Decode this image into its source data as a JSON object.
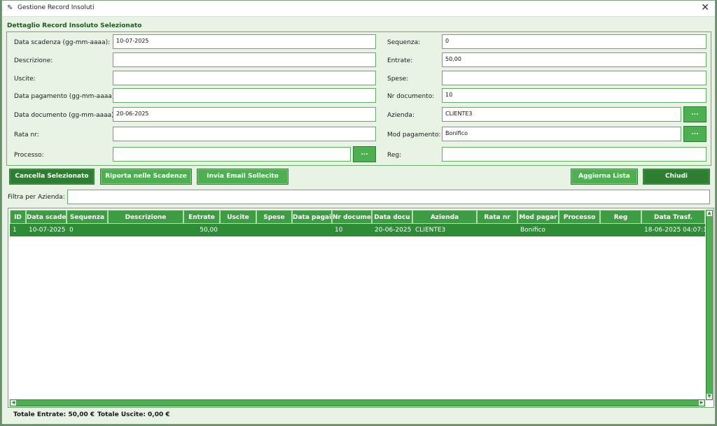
{
  "window": {
    "title": "Gestione Record Insoluti"
  },
  "detail": {
    "section_title": "Dettaglio Record Insoluto Selezionato",
    "fields": {
      "data_scadenza": {
        "label": "Data scadenza (gg-mm-aaaa):",
        "value": "10-07-2025"
      },
      "descrizione": {
        "label": "Descrizione:",
        "value": ""
      },
      "uscite": {
        "label": "Uscite:",
        "value": ""
      },
      "data_pagamento": {
        "label": "Data pagamento (gg-mm-aaaa):",
        "value": ""
      },
      "data_documento": {
        "label": "Data documento (gg-mm-aaaa):",
        "value": "20-06-2025"
      },
      "rata_nr": {
        "label": "Rata nr:",
        "value": ""
      },
      "processo": {
        "label": "Processo:",
        "value": ""
      },
      "sequenza": {
        "label": "Sequenza:",
        "value": "0"
      },
      "entrate": {
        "label": "Entrate:",
        "value": "50,00"
      },
      "spese": {
        "label": "Spese:",
        "value": ""
      },
      "nr_documento": {
        "label": "Nr documento:",
        "value": "10"
      },
      "azienda": {
        "label": "Azienda:",
        "value": "CLIENTE3"
      },
      "mod_pagamento": {
        "label": "Mod pagamento:",
        "value": "Bonifico"
      },
      "reg": {
        "label": "Reg:",
        "value": ""
      }
    },
    "browse_label": "..."
  },
  "buttons": {
    "cancella": "Cancella Selezionato",
    "riporta": "Riporta nelle Scadenze",
    "invia": "Invia Email Sollecito",
    "aggiorna": "Aggiorna Lista",
    "chiudi": "Chiudi"
  },
  "filter": {
    "label": "Filtra per Azienda:",
    "value": ""
  },
  "table": {
    "columns": [
      "ID",
      "Data scade",
      "Sequenza",
      "Descrizione",
      "Entrate",
      "Uscite",
      "Spese",
      "Data pagai",
      "Nr docume",
      "Data docu",
      "Azienda",
      "Rata nr",
      "Mod pagar",
      "Processo",
      "Reg",
      "Data Trasf."
    ],
    "rows": [
      [
        "1",
        "10-07-2025",
        "0",
        "",
        "50,00",
        "",
        "",
        "",
        "10",
        "20-06-2025",
        "CLIENTE3",
        "",
        "Bonifico",
        "",
        "",
        "18-06-2025 04:07:1"
      ]
    ]
  },
  "totals": {
    "entrate": "Totale Entrate: 50,00 €",
    "uscite": "Totale Uscite: 0,00 €"
  },
  "icons": {
    "app": "feather-icon",
    "close": "close-icon"
  },
  "colors": {
    "accent": "#4caf50",
    "accent_dark": "#2e7d32",
    "row_selected": "#2e8b36",
    "background": "#e8f3e6"
  }
}
